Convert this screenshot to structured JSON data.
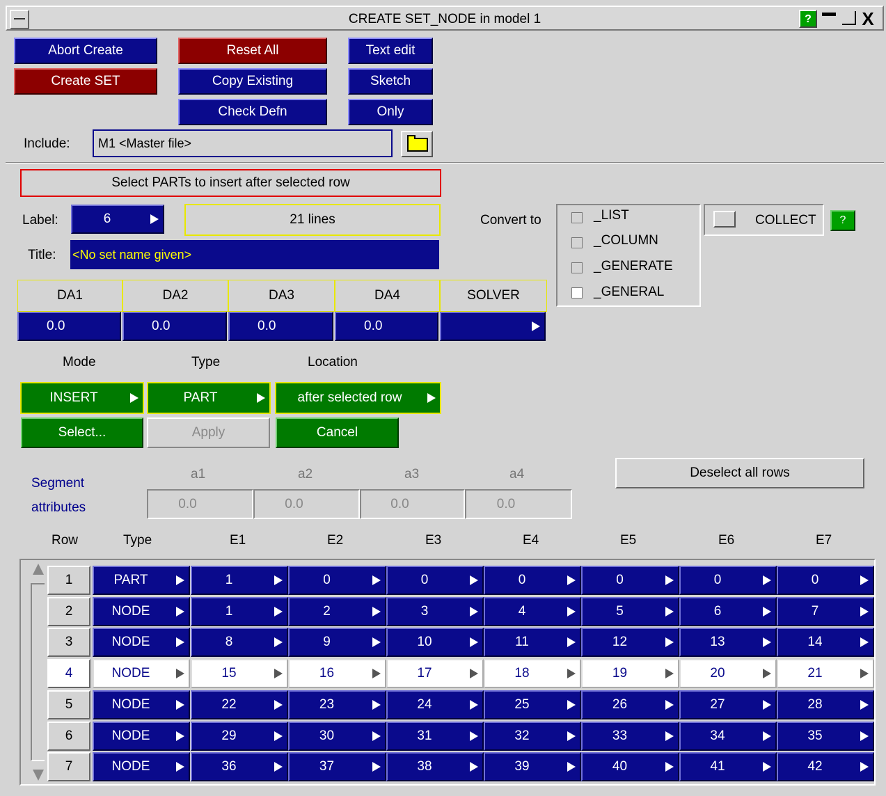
{
  "window": {
    "title": "CREATE SET_NODE in model 1",
    "help": "?",
    "minimize": "▁",
    "maximize": "▢",
    "close": "X"
  },
  "toolbar": {
    "abort_create": "Abort Create",
    "create_set": "Create SET",
    "reset_all": "Reset All",
    "copy_existing": "Copy Existing",
    "check_defn": "Check Defn",
    "text_edit": "Text edit",
    "sketch": "Sketch",
    "only": "Only"
  },
  "include": {
    "label": "Include:",
    "value": "M1  <Master file>"
  },
  "prompt": "Select PARTs to insert after selected row",
  "set": {
    "label_caption": "Label:",
    "label_value": "6",
    "lines": "21 lines",
    "title_caption": "Title:",
    "title_value": "<No set name given>"
  },
  "convert": {
    "caption": "Convert to",
    "options": [
      "_LIST",
      "_COLUMN",
      "_GENERATE",
      "_GENERAL"
    ],
    "collect": "COLLECT",
    "help": "?"
  },
  "da": {
    "headers": [
      "DA1",
      "DA2",
      "DA3",
      "DA4",
      "SOLVER"
    ],
    "values": [
      "0.0",
      "0.0",
      "0.0",
      "0.0",
      ""
    ]
  },
  "edit": {
    "mode_caption": "Mode",
    "type_caption": "Type",
    "location_caption": "Location",
    "mode": "INSERT",
    "type": "PART",
    "location": "after selected row",
    "select": "Select...",
    "apply": "Apply",
    "cancel": "Cancel"
  },
  "segment": {
    "caption_line1": "Segment",
    "caption_line2": "attributes",
    "headers": [
      "a1",
      "a2",
      "a3",
      "a4"
    ],
    "values": [
      "0.0",
      "0.0",
      "0.0",
      "0.0"
    ],
    "deselect": "Deselect all rows"
  },
  "table": {
    "columns": [
      "Row",
      "Type",
      "E1",
      "E2",
      "E3",
      "E4",
      "E5",
      "E6",
      "E7"
    ],
    "selected_row": 4,
    "rows": [
      {
        "row": "1",
        "type": "PART",
        "e": [
          "1",
          "0",
          "0",
          "0",
          "0",
          "0",
          "0"
        ]
      },
      {
        "row": "2",
        "type": "NODE",
        "e": [
          "1",
          "2",
          "3",
          "4",
          "5",
          "6",
          "7"
        ]
      },
      {
        "row": "3",
        "type": "NODE",
        "e": [
          "8",
          "9",
          "10",
          "11",
          "12",
          "13",
          "14"
        ]
      },
      {
        "row": "4",
        "type": "NODE",
        "e": [
          "15",
          "16",
          "17",
          "18",
          "19",
          "20",
          "21"
        ]
      },
      {
        "row": "5",
        "type": "NODE",
        "e": [
          "22",
          "23",
          "24",
          "25",
          "26",
          "27",
          "28"
        ]
      },
      {
        "row": "6",
        "type": "NODE",
        "e": [
          "29",
          "30",
          "31",
          "32",
          "33",
          "34",
          "35"
        ]
      },
      {
        "row": "7",
        "type": "NODE",
        "e": [
          "36",
          "37",
          "38",
          "39",
          "40",
          "41",
          "42"
        ]
      }
    ]
  },
  "colors": {
    "blue": "#0a0a8c",
    "red": "#8c0000",
    "green": "#007a00",
    "panel": "#d4d4d4",
    "title_text": "#ffff00",
    "caption_blue": "#00008c"
  }
}
